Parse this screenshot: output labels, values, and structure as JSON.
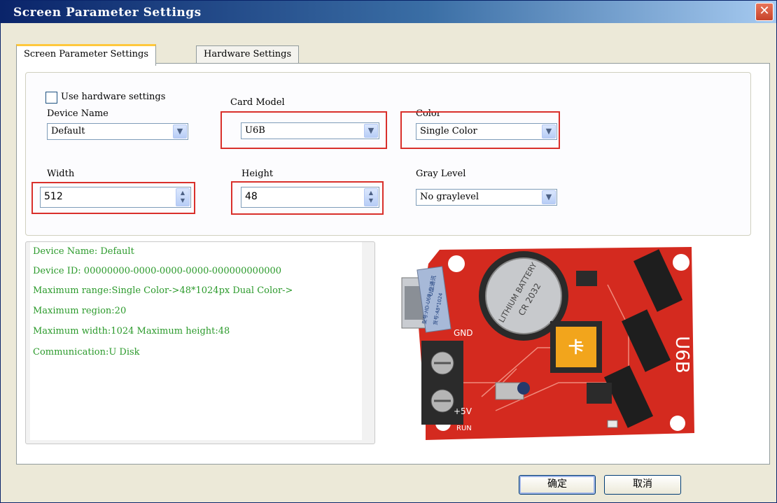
{
  "window": {
    "title": "Screen Parameter Settings",
    "close_glyph": "✕"
  },
  "tabs": [
    {
      "label": "Screen Parameter Settings",
      "active": true
    },
    {
      "label": "Hardware Settings",
      "active": false
    }
  ],
  "form": {
    "use_hardware_label": "Use hardware settings",
    "use_hardware_checked": false,
    "device_name_label": "Device Name",
    "device_name_value": "Default",
    "card_model_label": "Card Model",
    "card_model_value": "U6B",
    "color_label": "Color",
    "color_value": "Single Color",
    "width_label": "Width",
    "width_value": "512",
    "height_label": "Height",
    "height_value": "48",
    "gray_level_label": "Gray Level",
    "gray_level_value": "No graylevel"
  },
  "info": {
    "lines": [
      "Device Name: Default",
      "Device ID:  00000000-0000-0000-0000-000000000000",
      "Maximum range:Single Color->48*1024px  Dual Color->",
      "Maximum region:20",
      "Maximum width:1024 Maximum height:48",
      "Communication:U Disk"
    ]
  },
  "board": {
    "model_text": "U6B",
    "chip_text": "卡",
    "battery_text": "CR 2032",
    "battery_sub": "LITHIUM BATTERY",
    "gnd_text": "GND",
    "plus5v_text": "+5V",
    "run_text": "RUN",
    "sticker_line1": "U盘通讯",
    "sticker_line2": "型号:HD-U6B",
    "sticker_line3": "货号:48*1024"
  },
  "buttons": {
    "ok": "确定",
    "cancel": "取消"
  },
  "icons": {
    "dropdown": "▼",
    "spin_up": "▲",
    "spin_down": "▼"
  },
  "colors": {
    "title_bar": "#0a246a",
    "highlight": "#d9302b",
    "info_text": "#2b9a2b",
    "board_red": "#d42a1f"
  }
}
